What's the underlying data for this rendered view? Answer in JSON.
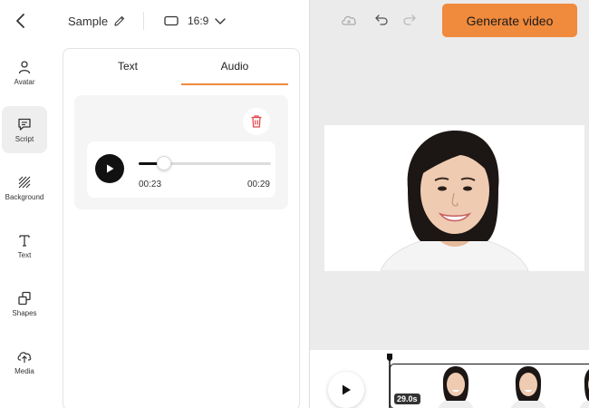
{
  "header": {
    "back_icon": "chevron-left-icon",
    "project_name": "Sample",
    "edit_icon": "pencil-icon",
    "ratio_icon": "rectangle-icon",
    "aspect_ratio": "16:9",
    "ratio_dropdown_icon": "chevron-down-icon"
  },
  "sidebar": {
    "items": [
      {
        "label": "Avatar",
        "icon": "person-icon"
      },
      {
        "label": "Script",
        "icon": "speech-bubble-icon",
        "active": true
      },
      {
        "label": "Background",
        "icon": "hatch-pattern-icon"
      },
      {
        "label": "Text",
        "icon": "text-icon"
      },
      {
        "label": "Shapes",
        "icon": "shapes-icon"
      },
      {
        "label": "Media",
        "icon": "cloud-upload-icon"
      }
    ]
  },
  "panel": {
    "tabs": [
      {
        "label": "Text",
        "active": false
      },
      {
        "label": "Audio",
        "active": true
      }
    ],
    "audio": {
      "delete_icon": "trash-icon",
      "play_icon": "play-icon",
      "current_time": "00:23",
      "total_time": "00:29",
      "progress": 0.19
    }
  },
  "toolbar": {
    "cloud_icon": "cloud-icon",
    "undo_icon": "undo-icon",
    "redo_icon": "redo-icon",
    "generate_label": "Generate video"
  },
  "timeline": {
    "play_icon": "play-icon",
    "clip_duration": "29.0s"
  },
  "colors": {
    "accent": "#f08a3c",
    "delete": "#e5484d"
  }
}
